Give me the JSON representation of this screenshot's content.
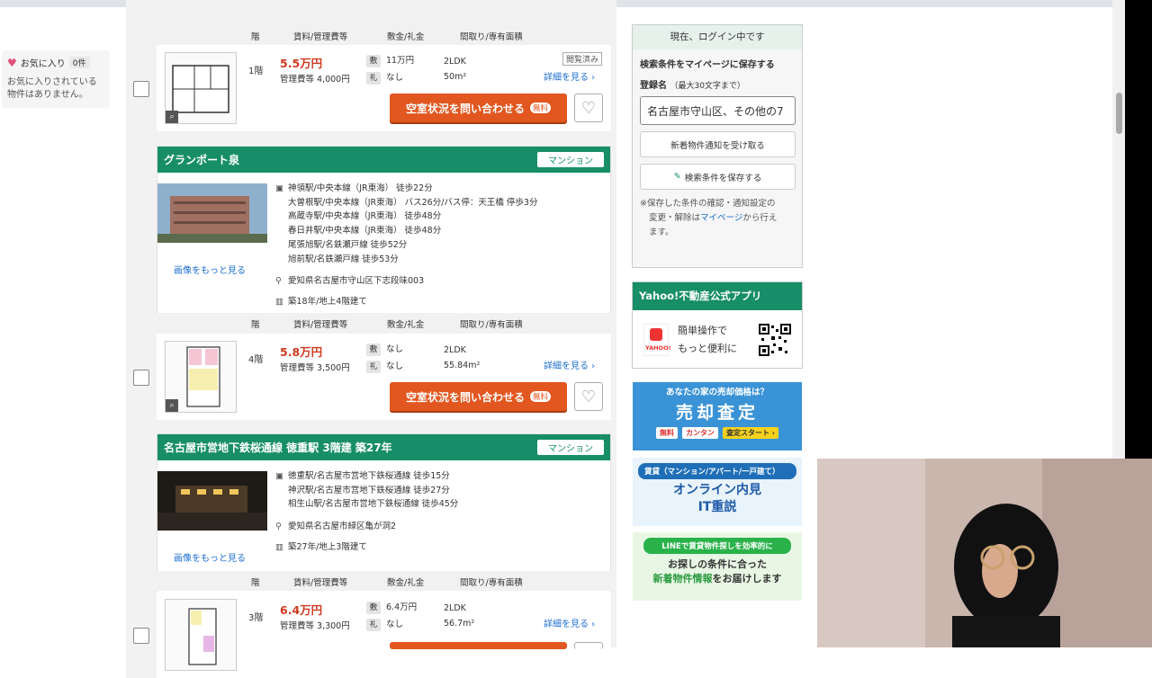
{
  "favorites": {
    "label": "お気に入り",
    "count": "0件",
    "empty_text_1": "お気に入りされている",
    "empty_text_2": "物件はありません。"
  },
  "column_headers": {
    "floor": "階",
    "rent": "賃料/管理費等",
    "deposit": "敷金/礼金",
    "layout": "間取り/専有面積"
  },
  "listings": [
    {
      "room": {
        "floor": "1階",
        "rent": "5.5万円",
        "mgmt": "管理費等 4,000円",
        "shiki_tag": "敷",
        "shiki": "11万円",
        "rei_tag": "礼",
        "rei": "なし",
        "layout": "2LDK",
        "area": "50m²",
        "viewed": "閲覧済み",
        "details": "詳細を見る",
        "inquire": "空室状況を問い合わせる",
        "free": "無料"
      }
    },
    {
      "title": "グランポート泉",
      "type": "マンション",
      "stations": [
        "神領駅/中央本線（JR東海） 徒歩22分",
        "大曽根駅/中央本線（JR東海） バス26分/バス停：天王橋 停歩3分",
        "高蔵寺駅/中央本線（JR東海） 徒歩48分",
        "春日井駅/中央本線（JR東海） 徒歩48分",
        "尾張旭駅/名鉄瀬戸線 徒歩52分",
        "旭前駅/名鉄瀬戸線 徒歩53分"
      ],
      "address": "愛知県名古屋市守山区下志段味003",
      "age": "築18年/地上4階建て",
      "more_photos": "画像をもっと見る",
      "room": {
        "floor": "4階",
        "rent": "5.8万円",
        "mgmt": "管理費等 3,500円",
        "shiki_tag": "敷",
        "shiki": "なし",
        "rei_tag": "礼",
        "rei": "なし",
        "layout": "2LDK",
        "area": "55.84m²",
        "details": "詳細を見る",
        "inquire": "空室状況を問い合わせる",
        "free": "無料"
      }
    },
    {
      "title": "名古屋市営地下鉄桜通線 徳重駅 3階建 築27年",
      "type": "マンション",
      "stations": [
        "徳重駅/名古屋市営地下鉄桜通線 徒歩15分",
        "神沢駅/名古屋市営地下鉄桜通線 徒歩27分",
        "相生山駅/名古屋市営地下鉄桜通線 徒歩45分"
      ],
      "address": "愛知県名古屋市緑区亀が洞2",
      "age": "築27年/地上3階建て",
      "more_photos": "画像をもっと見る",
      "room": {
        "floor": "3階",
        "rent": "6.4万円",
        "mgmt": "管理費等 3,300円",
        "shiki_tag": "敷",
        "shiki": "6.4万円",
        "rei_tag": "礼",
        "rei": "なし",
        "layout": "2LDK",
        "area": "56.7m²",
        "details": "詳細を見る"
      }
    }
  ],
  "sidebar": {
    "login_status": "現在、ログイン中です",
    "save_to_mypage": "検索条件をマイページに保存する",
    "reg_name_label": "登録名",
    "reg_name_hint": "（最大30文字まで）",
    "reg_name_value": "名古屋市守山区、その他の7",
    "notify_button": "新着物件通知を受け取る",
    "save_button": "検索条件を保存する",
    "note_prefix": "※保存した条件の確認・通知設定の",
    "note_mid": "変更・解除は",
    "note_link": "マイページ",
    "note_suffix": "から行え",
    "note_end": "ます。",
    "app_title": "Yahoo!不動産公式アプリ",
    "app_logo_text": "YAHOO!",
    "app_line1": "簡単操作で",
    "app_line2": "もっと便利に"
  },
  "banners": {
    "sale_top": "あなたの家の売却価格は？",
    "sale_main": "売却査定",
    "sale_free": "無料",
    "sale_easy": "カンタン",
    "sale_start": "査定スタート ›",
    "online_top": "賃貸（マンション/アパート/一戸建て）",
    "online_main1": "オンライン内見",
    "online_main2": "IT重説",
    "line_top": "LINEで賃貸物件探しを効率的に",
    "line_main1": "お探しの条件に合った",
    "line_main2a": "新着物件情報",
    "line_main2b": "をお届けします"
  },
  "colors": {
    "brand_green": "#178e67",
    "accent_orange": "#e2571f",
    "price_red": "#d0391f",
    "link_blue": "#1d6fd0"
  }
}
